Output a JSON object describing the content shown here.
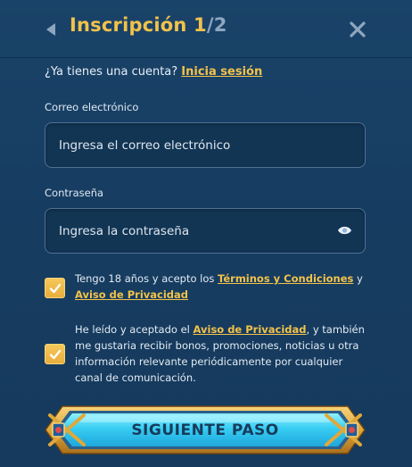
{
  "header": {
    "title_prefix": "Inscripción ",
    "step_current": "1",
    "step_total": "/2",
    "back_icon": "back-arrow-icon",
    "close_icon": "close-icon"
  },
  "login": {
    "prompt": "¿Ya tienes una cuenta? ",
    "link": "Inicia sesión"
  },
  "email": {
    "label": "Correo electrónico",
    "placeholder": "Ingresa el correo electrónico",
    "value": ""
  },
  "password": {
    "label": "Contraseña",
    "placeholder": "Ingresa la contraseña",
    "value": "",
    "toggle_icon": "eye-icon"
  },
  "consent_age": {
    "checked": true,
    "text_before": "Tengo 18 años y acepto los ",
    "terms_link": "Términos y Condiciones",
    "text_mid": " y",
    "privacy_link": "Aviso de Privacidad"
  },
  "consent_marketing": {
    "checked": true,
    "text_before": "He leído y aceptado el ",
    "privacy_link": "Aviso de Privacidad",
    "text_after": ", y también me gustaria recibir bonos, promociones, noticias u otra información relevante periódicamente por cualquier canal de comunicación."
  },
  "next_button": {
    "label": "SIGUIENTE PASO"
  },
  "colors": {
    "background": "#173f63",
    "accent": "#f2c24b",
    "input_bg": "#123554",
    "input_border": "#4f7195",
    "button_cyan": "#2fc7ee",
    "button_frame_gold": "#e0a83a"
  }
}
